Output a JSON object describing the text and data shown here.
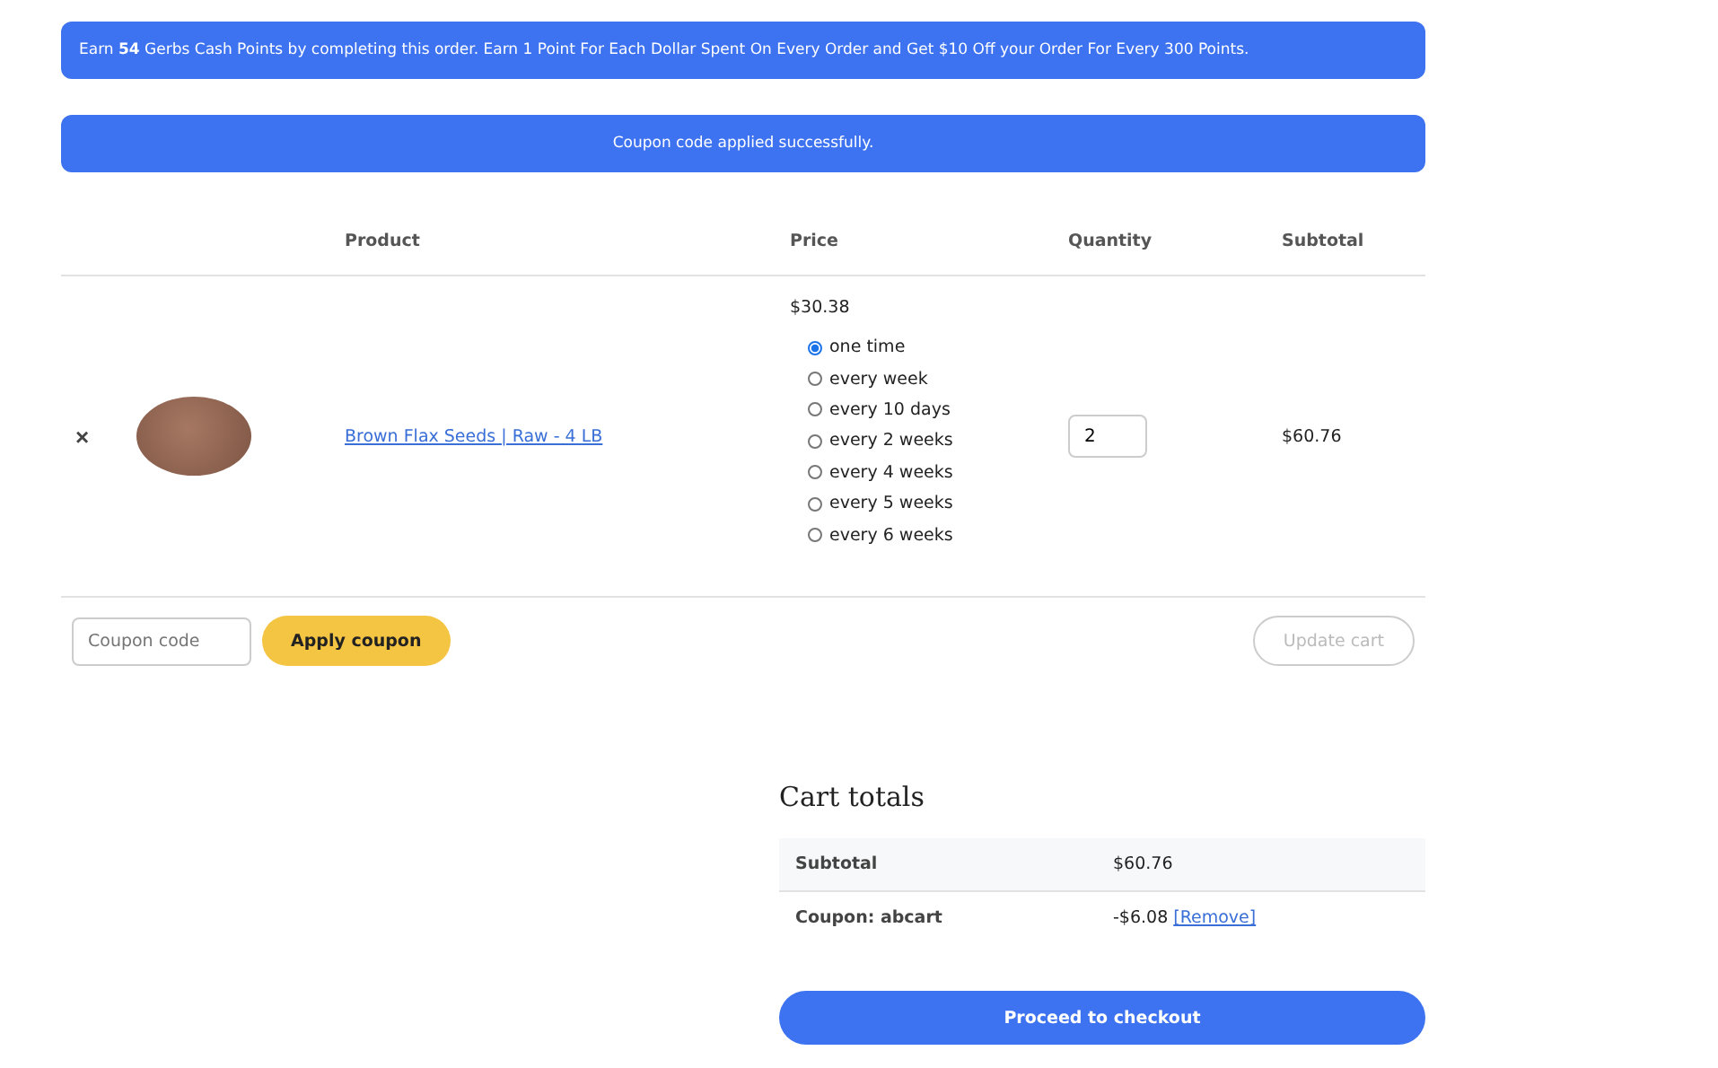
{
  "notices": [
    {
      "text": "Earn **54** Gerbs Cash Points by completing this order. Earn 1 Point For Each Dollar Spent On Every Order and Get $10 Off your Order For Every 300 Points.",
      "kind": "info"
    },
    {
      "text": "Coupon code applied successfully.",
      "kind": "message"
    }
  ],
  "cart_table": {
    "columns": [
      "Product",
      "Price",
      "Quantity",
      "Subtotal"
    ],
    "rows": [
      {
        "remove": "×",
        "product": "Brown Flax Seeds | Raw - 4 LB",
        "price": "$30.38",
        "options": [
          {
            "label": "one time",
            "selected": true
          },
          {
            "label": "every week",
            "selected": false
          },
          {
            "label": "every 10 days",
            "selected": false
          },
          {
            "label": "every 2 weeks",
            "selected": false
          },
          {
            "label": "every 4 weeks",
            "selected": false
          },
          {
            "label": "every 5 weeks",
            "selected": false
          },
          {
            "label": "every 6 weeks",
            "selected": false
          }
        ],
        "quantity": "2",
        "subtotal": "$60.76"
      }
    ]
  },
  "actions": {
    "coupon_placeholder": "Coupon code",
    "apply_button": "Apply coupon",
    "update_button": {
      "label": "Update cart",
      "disabled": true
    }
  },
  "cart_totals": {
    "title": "Cart totals",
    "rows": [
      {
        "label": "Subtotal",
        "value": "$60.76"
      },
      {
        "label": "Coupon: abcart",
        "value": "-$6.08",
        "link": "[Remove]"
      }
    ],
    "checkout_button": "Proceed to checkout"
  }
}
